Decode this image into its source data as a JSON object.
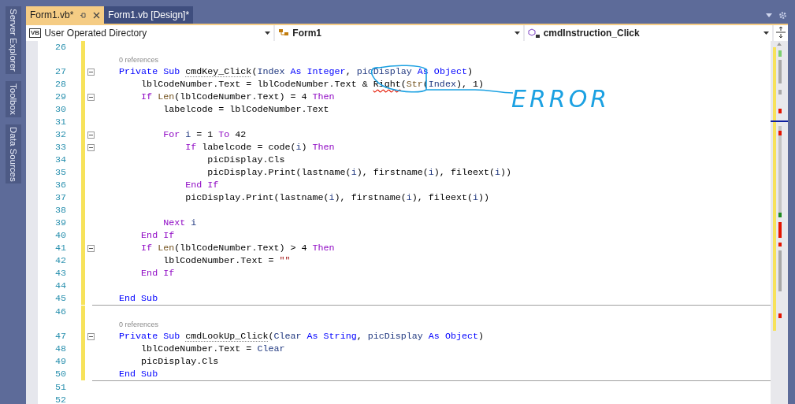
{
  "side_panels": [
    {
      "label": "Server Explorer"
    },
    {
      "label": "Toolbox"
    },
    {
      "label": "Data Sources"
    }
  ],
  "tabs": [
    {
      "label": "Form1.vb*",
      "selected": true
    },
    {
      "label": "Form1.vb [Design]*",
      "selected": false
    }
  ],
  "nav_bar": [
    {
      "kind": "project",
      "badge": "VB",
      "label": "User Operated Directory"
    },
    {
      "kind": "class",
      "label": "Form1"
    },
    {
      "kind": "member",
      "label": "cmdInstruction_Click"
    }
  ],
  "editor": {
    "lines": [
      {
        "number": "26",
        "foldable": false,
        "changed": true,
        "rule_after": false
      },
      {
        "number": "27",
        "references": "0 references",
        "foldable": true,
        "changed": true,
        "rule_after": false,
        "tokens": [
          {
            "kind": "kw",
            "text": "    Private Sub "
          },
          {
            "kind": "plain",
            "text": "cmdKey_Click",
            "dotted": true
          },
          {
            "kind": "plain",
            "text": "("
          },
          {
            "kind": "id",
            "text": "Index"
          },
          {
            "kind": "kw",
            "text": " As Integer"
          },
          {
            "kind": "plain",
            "text": ", "
          },
          {
            "kind": "id",
            "text": "picDisplay"
          },
          {
            "kind": "kw",
            "text": " As Object"
          },
          {
            "kind": "plain",
            "text": ")"
          }
        ]
      },
      {
        "number": "28",
        "foldable": false,
        "changed": true,
        "rule_after": false,
        "tokens": [
          {
            "kind": "plain",
            "text": "        lblCodeNumber.Text = lblCodeNumber.Text & "
          },
          {
            "kind": "plain",
            "text": "Right",
            "squiggle": true
          },
          {
            "kind": "plain",
            "text": "("
          },
          {
            "kind": "fn",
            "text": "Str"
          },
          {
            "kind": "plain",
            "text": "("
          },
          {
            "kind": "id",
            "text": "Index"
          },
          {
            "kind": "plain",
            "text": "), 1)"
          }
        ]
      },
      {
        "number": "29",
        "foldable": true,
        "changed": true,
        "rule_after": false,
        "tokens": [
          {
            "kind": "ctl",
            "text": "        If "
          },
          {
            "kind": "fn",
            "text": "Len"
          },
          {
            "kind": "plain",
            "text": "(lblCodeNumber.Text) = 4 "
          },
          {
            "kind": "ctl",
            "text": "Then"
          }
        ]
      },
      {
        "number": "30",
        "foldable": false,
        "changed": true,
        "rule_after": false,
        "tokens": [
          {
            "kind": "plain",
            "text": "            labelcode = lblCodeNumber.Text"
          }
        ]
      },
      {
        "number": "31",
        "foldable": false,
        "changed": true,
        "rule_after": false
      },
      {
        "number": "32",
        "foldable": true,
        "changed": true,
        "rule_after": false,
        "tokens": [
          {
            "kind": "ctl",
            "text": "            For "
          },
          {
            "kind": "id",
            "text": "i"
          },
          {
            "kind": "plain",
            "text": " = 1 "
          },
          {
            "kind": "ctl",
            "text": "To"
          },
          {
            "kind": "plain",
            "text": " 42"
          }
        ]
      },
      {
        "number": "33",
        "foldable": true,
        "changed": true,
        "rule_after": false,
        "tokens": [
          {
            "kind": "ctl",
            "text": "                If"
          },
          {
            "kind": "plain",
            "text": " labelcode = code("
          },
          {
            "kind": "id",
            "text": "i"
          },
          {
            "kind": "plain",
            "text": ") "
          },
          {
            "kind": "ctl",
            "text": "Then"
          }
        ]
      },
      {
        "number": "34",
        "foldable": false,
        "changed": true,
        "rule_after": false,
        "tokens": [
          {
            "kind": "plain",
            "text": "                    picDisplay.Cls"
          }
        ]
      },
      {
        "number": "35",
        "foldable": false,
        "changed": true,
        "rule_after": false,
        "tokens": [
          {
            "kind": "plain",
            "text": "                    picDisplay.Print(lastname("
          },
          {
            "kind": "id",
            "text": "i"
          },
          {
            "kind": "plain",
            "text": "), firstname("
          },
          {
            "kind": "id",
            "text": "i"
          },
          {
            "kind": "plain",
            "text": "), fileext("
          },
          {
            "kind": "id",
            "text": "i"
          },
          {
            "kind": "plain",
            "text": "))"
          }
        ]
      },
      {
        "number": "36",
        "foldable": false,
        "changed": true,
        "rule_after": false,
        "tokens": [
          {
            "kind": "ctl",
            "text": "                End If"
          }
        ]
      },
      {
        "number": "37",
        "foldable": false,
        "changed": true,
        "rule_after": false,
        "tokens": [
          {
            "kind": "plain",
            "text": "                picDisplay.Print(lastname("
          },
          {
            "kind": "id",
            "text": "i"
          },
          {
            "kind": "plain",
            "text": "), firstname("
          },
          {
            "kind": "id",
            "text": "i"
          },
          {
            "kind": "plain",
            "text": "), fileext("
          },
          {
            "kind": "id",
            "text": "i"
          },
          {
            "kind": "plain",
            "text": "))"
          }
        ]
      },
      {
        "number": "38",
        "foldable": false,
        "changed": true,
        "rule_after": false
      },
      {
        "number": "39",
        "foldable": false,
        "changed": true,
        "rule_after": false,
        "tokens": [
          {
            "kind": "ctl",
            "text": "            Next "
          },
          {
            "kind": "id",
            "text": "i"
          }
        ]
      },
      {
        "number": "40",
        "foldable": false,
        "changed": true,
        "rule_after": false,
        "tokens": [
          {
            "kind": "ctl",
            "text": "        End If"
          }
        ]
      },
      {
        "number": "41",
        "foldable": true,
        "changed": true,
        "rule_after": false,
        "tokens": [
          {
            "kind": "ctl",
            "text": "        If "
          },
          {
            "kind": "fn",
            "text": "Len"
          },
          {
            "kind": "plain",
            "text": "(lblCodeNumber.Text) > 4 "
          },
          {
            "kind": "ctl",
            "text": "Then"
          }
        ]
      },
      {
        "number": "42",
        "foldable": false,
        "changed": true,
        "rule_after": false,
        "tokens": [
          {
            "kind": "plain",
            "text": "            lblCodeNumber.Text = "
          },
          {
            "kind": "str",
            "text": "\"\""
          }
        ]
      },
      {
        "number": "43",
        "foldable": false,
        "changed": true,
        "rule_after": false,
        "tokens": [
          {
            "kind": "ctl",
            "text": "        End If"
          }
        ]
      },
      {
        "number": "44",
        "foldable": false,
        "changed": true,
        "rule_after": false
      },
      {
        "number": "45",
        "foldable": false,
        "changed": true,
        "rule_after": true,
        "tokens": [
          {
            "kind": "kw",
            "text": "    End Sub"
          }
        ]
      },
      {
        "number": "46",
        "foldable": false,
        "changed": true,
        "rule_after": false
      },
      {
        "number": "47",
        "references": "0 references",
        "foldable": true,
        "changed": true,
        "rule_after": false,
        "tokens": [
          {
            "kind": "kw",
            "text": "    Private Sub "
          },
          {
            "kind": "plain",
            "text": "cmdLookUp_Click",
            "dotted": true
          },
          {
            "kind": "plain",
            "text": "("
          },
          {
            "kind": "id",
            "text": "Clear"
          },
          {
            "kind": "kw",
            "text": " As String"
          },
          {
            "kind": "plain",
            "text": ", "
          },
          {
            "kind": "id",
            "text": "picDisplay"
          },
          {
            "kind": "kw",
            "text": " As Object"
          },
          {
            "kind": "plain",
            "text": ")"
          }
        ]
      },
      {
        "number": "48",
        "foldable": false,
        "changed": true,
        "rule_after": false,
        "tokens": [
          {
            "kind": "plain",
            "text": "        lblCodeNumber.Text = "
          },
          {
            "kind": "id",
            "text": "Clear"
          }
        ]
      },
      {
        "number": "49",
        "foldable": false,
        "changed": true,
        "rule_after": false,
        "tokens": [
          {
            "kind": "plain",
            "text": "        picDisplay.Cls"
          }
        ]
      },
      {
        "number": "50",
        "foldable": false,
        "changed": true,
        "rule_after": true,
        "tokens": [
          {
            "kind": "kw",
            "text": "    End Sub"
          }
        ]
      },
      {
        "number": "51",
        "foldable": false,
        "changed": false,
        "rule_after": false
      },
      {
        "number": "52",
        "foldable": false,
        "changed": false,
        "rule_after": false
      }
    ]
  },
  "annotation": {
    "text": "ERROR"
  }
}
